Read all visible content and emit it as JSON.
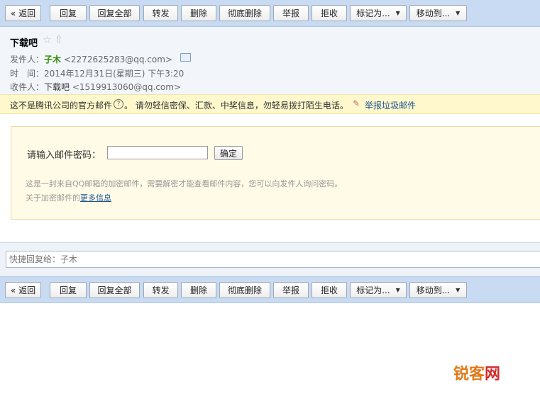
{
  "toolbar": {
    "back": "« 返回",
    "reply": "回复",
    "reply_all": "回复全部",
    "forward": "转发",
    "delete": "删除",
    "delete_forever": "彻底删除",
    "report": "举报",
    "reject": "拒收",
    "mark_as": "标记为...",
    "move_to": "移动到..."
  },
  "mail": {
    "subject": "下载吧",
    "from_label": "发件人：",
    "from_name": "子木",
    "from_addr": "<2272625283@qq.com>",
    "time_label": "时　间：",
    "time_value": "2014年12月31日(星期三) 下午3:20",
    "to_label": "收件人：",
    "to_name": "下载吧",
    "to_addr": "<1519913060@qq.com>"
  },
  "warning": {
    "not_official": "这不是腾讯公司的官方邮件",
    "qmark": "?",
    "caution": "。 请勿轻信密保、汇款、中奖信息，勿轻易拨打陌生电话。",
    "report_spam": "举报垃圾邮件"
  },
  "encrypted": {
    "prompt": "请输入邮件密码：",
    "password_value": "",
    "confirm": "确定",
    "description": "这是一封来自QQ邮箱的加密邮件，需要解密才能查看邮件内容，您可以向发件人询问密码。",
    "more_prefix": "关于加密邮件的",
    "more_link": "更多信息"
  },
  "quick_reply": {
    "placeholder": "快捷回复给：子木"
  },
  "watermark": {
    "part1": "锐客",
    "part2": "网"
  }
}
